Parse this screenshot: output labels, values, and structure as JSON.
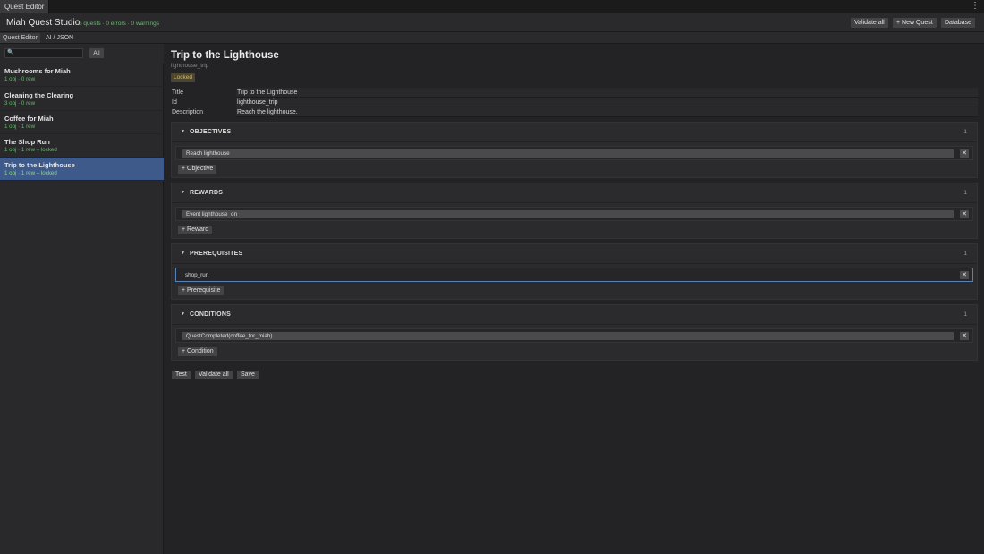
{
  "window": {
    "tab_label": "Quest Editor",
    "menu_glyph": "⋮"
  },
  "header": {
    "app_title": "Miah Quest Studio",
    "status": "5 quests · 0 errors · 0 warnings",
    "buttons": {
      "validate_all": "Validate all",
      "new_quest": "+ New Quest",
      "database": "Database"
    }
  },
  "subtabs": [
    {
      "label": "Quest Editor",
      "active": true
    },
    {
      "label": "AI / JSON",
      "active": false
    }
  ],
  "sidebar": {
    "search": {
      "value": "",
      "placeholder": "",
      "icon": "🔍"
    },
    "filter_label": "All",
    "quests": [
      {
        "name": "Mushrooms for Miah",
        "meta": "1 obj · 0 rew",
        "selected": false
      },
      {
        "name": "Cleaning the Clearing",
        "meta": "3 obj · 0 rew",
        "selected": false
      },
      {
        "name": "Coffee for Miah",
        "meta": "1 obj · 1 rew",
        "selected": false
      },
      {
        "name": "The Shop Run",
        "meta": "1 obj · 1 rew – locked",
        "selected": false
      },
      {
        "name": "Trip to the Lighthouse",
        "meta": "1 obj · 1 rew – locked",
        "selected": true
      }
    ]
  },
  "quest": {
    "title": "Trip to the Lighthouse",
    "id": "lighthouse_trip",
    "badge": "Locked",
    "fields": {
      "title": {
        "label": "Title",
        "value": "Trip to the Lighthouse"
      },
      "id": {
        "label": "Id",
        "value": "lighthouse_trip"
      },
      "description": {
        "label": "Description",
        "value": "Reach the lighthouse."
      }
    },
    "sections": {
      "objectives": {
        "title": "OBJECTIVES",
        "count": "1",
        "entry": "Reach lighthouse",
        "add_label": "+ Objective"
      },
      "rewards": {
        "title": "REWARDS",
        "count": "1",
        "entry": "Event lighthouse_on",
        "add_label": "+ Reward"
      },
      "prerequisites": {
        "title": "PREREQUISITES",
        "count": "1",
        "entry": "shop_run",
        "add_label": "+ Prerequisite"
      },
      "conditions": {
        "title": "CONDITIONS",
        "count": "1",
        "entry": "QuestCompleted(coffee_for_miah)",
        "add_label": "+ Condition"
      }
    },
    "caret": "▼",
    "remove_glyph": "✕",
    "footer": {
      "test": "Test",
      "validate_all": "Validate all",
      "save": "Save"
    }
  },
  "colors": {
    "accent_selected": "#3e5a8a",
    "status_green": "#66b86a",
    "locked_gold": "#d7b95a",
    "focus_blue": "#5a80b8"
  }
}
